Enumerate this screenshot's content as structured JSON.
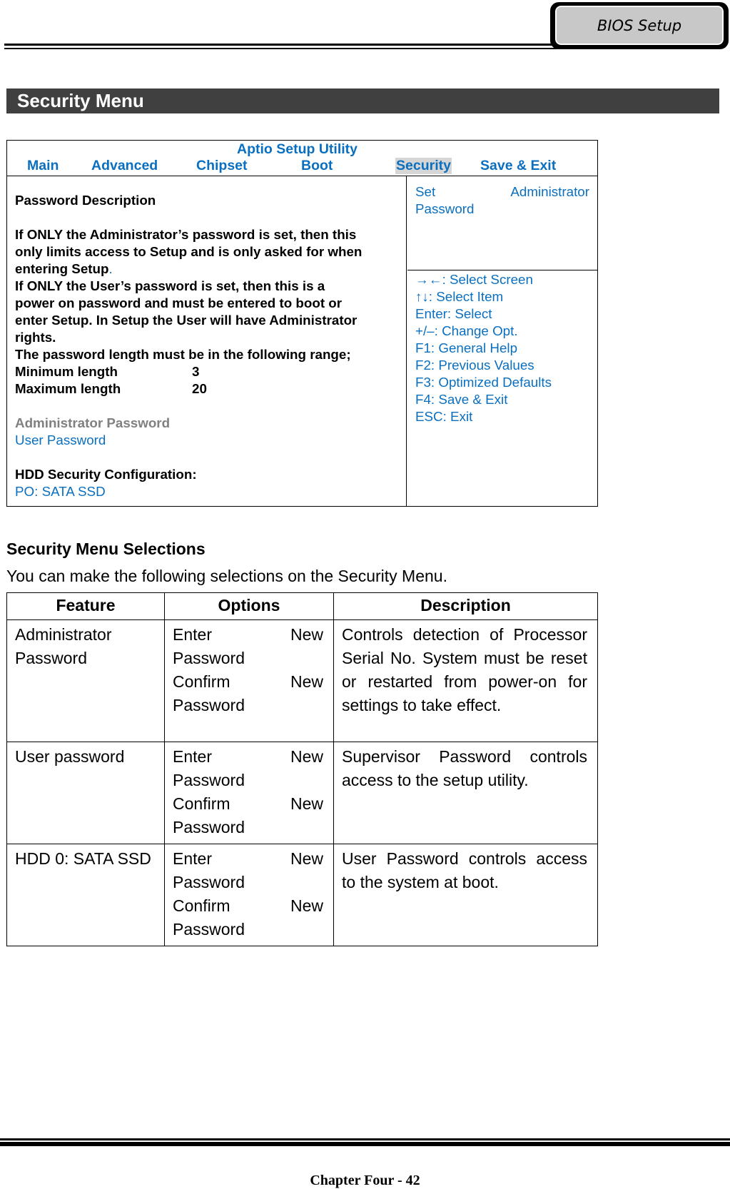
{
  "header": {
    "tab_label": "BIOS Setup"
  },
  "banner": {
    "title": "Security Menu"
  },
  "bios": {
    "utility_title": "Aptio Setup Utility",
    "menu": [
      {
        "label": "Main",
        "active": false
      },
      {
        "label": "Advanced",
        "active": false
      },
      {
        "label": "Chipset",
        "active": false
      },
      {
        "label": "Boot",
        "active": false
      },
      {
        "label": "Security",
        "active": true
      },
      {
        "label": "Save & Exit",
        "active": false
      }
    ],
    "highlight_color": "#d6d6d6",
    "accent_color": "#0b6fbf",
    "left": {
      "heading": "Password Description",
      "para1_line1": "If ONLY the Administrator’s password is set, then this",
      "para1_line2": "only limits access to Setup and is only asked for when",
      "para1_line3": "entering Setup",
      "para1_dot": ".",
      "para2_line1": "If ONLY the User’s password is set, then this is a",
      "para2_line2": "power on password and must be entered to boot or",
      "para2_line3": "enter Setup. In Setup the User will have Administrator",
      "para2_line4": "rights.",
      "range_line": "The password length must be in the following range;",
      "min_label": "Minimum length",
      "min_value": "3",
      "max_label": "Maximum length",
      "max_value": "20",
      "admin_password": "Administrator Password",
      "user_password": "User Password",
      "hdd_heading": "HDD Security Configuration:",
      "hdd_item": "PO: SATA SSD"
    },
    "item_help": {
      "word1": "Set",
      "word2": "Administrator",
      "word3": "Password"
    },
    "keys": [
      "→←: Select Screen",
      "↑↓: Select Item",
      "Enter: Select",
      "+/–: Change Opt.",
      "F1: General Help",
      "F2: Previous Values",
      "F3: Optimized Defaults",
      "F4: Save & Exit",
      "ESC: Exit"
    ]
  },
  "section": {
    "heading": "Security Menu Selections",
    "subtitle": "You can make the following selections on the Security Menu."
  },
  "table": {
    "headers": [
      "Feature",
      "Options",
      "Description"
    ],
    "rows": [
      {
        "feature": "Administrator Password",
        "options": [
          "Enter New Password",
          "Confirm New Password"
        ],
        "description": "Controls detection of Processor Serial No. System must be reset or restarted from power-on for settings to take effect."
      },
      {
        "feature": "User password",
        "options": [
          "Enter New Password",
          "Confirm New Password"
        ],
        "description": "Supervisor Password controls access to the setup utility."
      },
      {
        "feature": "HDD 0: SATA SSD",
        "options": [
          "Enter New Password",
          "Confirm New Password"
        ],
        "description": "User Password controls access to the system at boot."
      }
    ]
  },
  "footer": {
    "text": "Chapter Four - 42"
  }
}
